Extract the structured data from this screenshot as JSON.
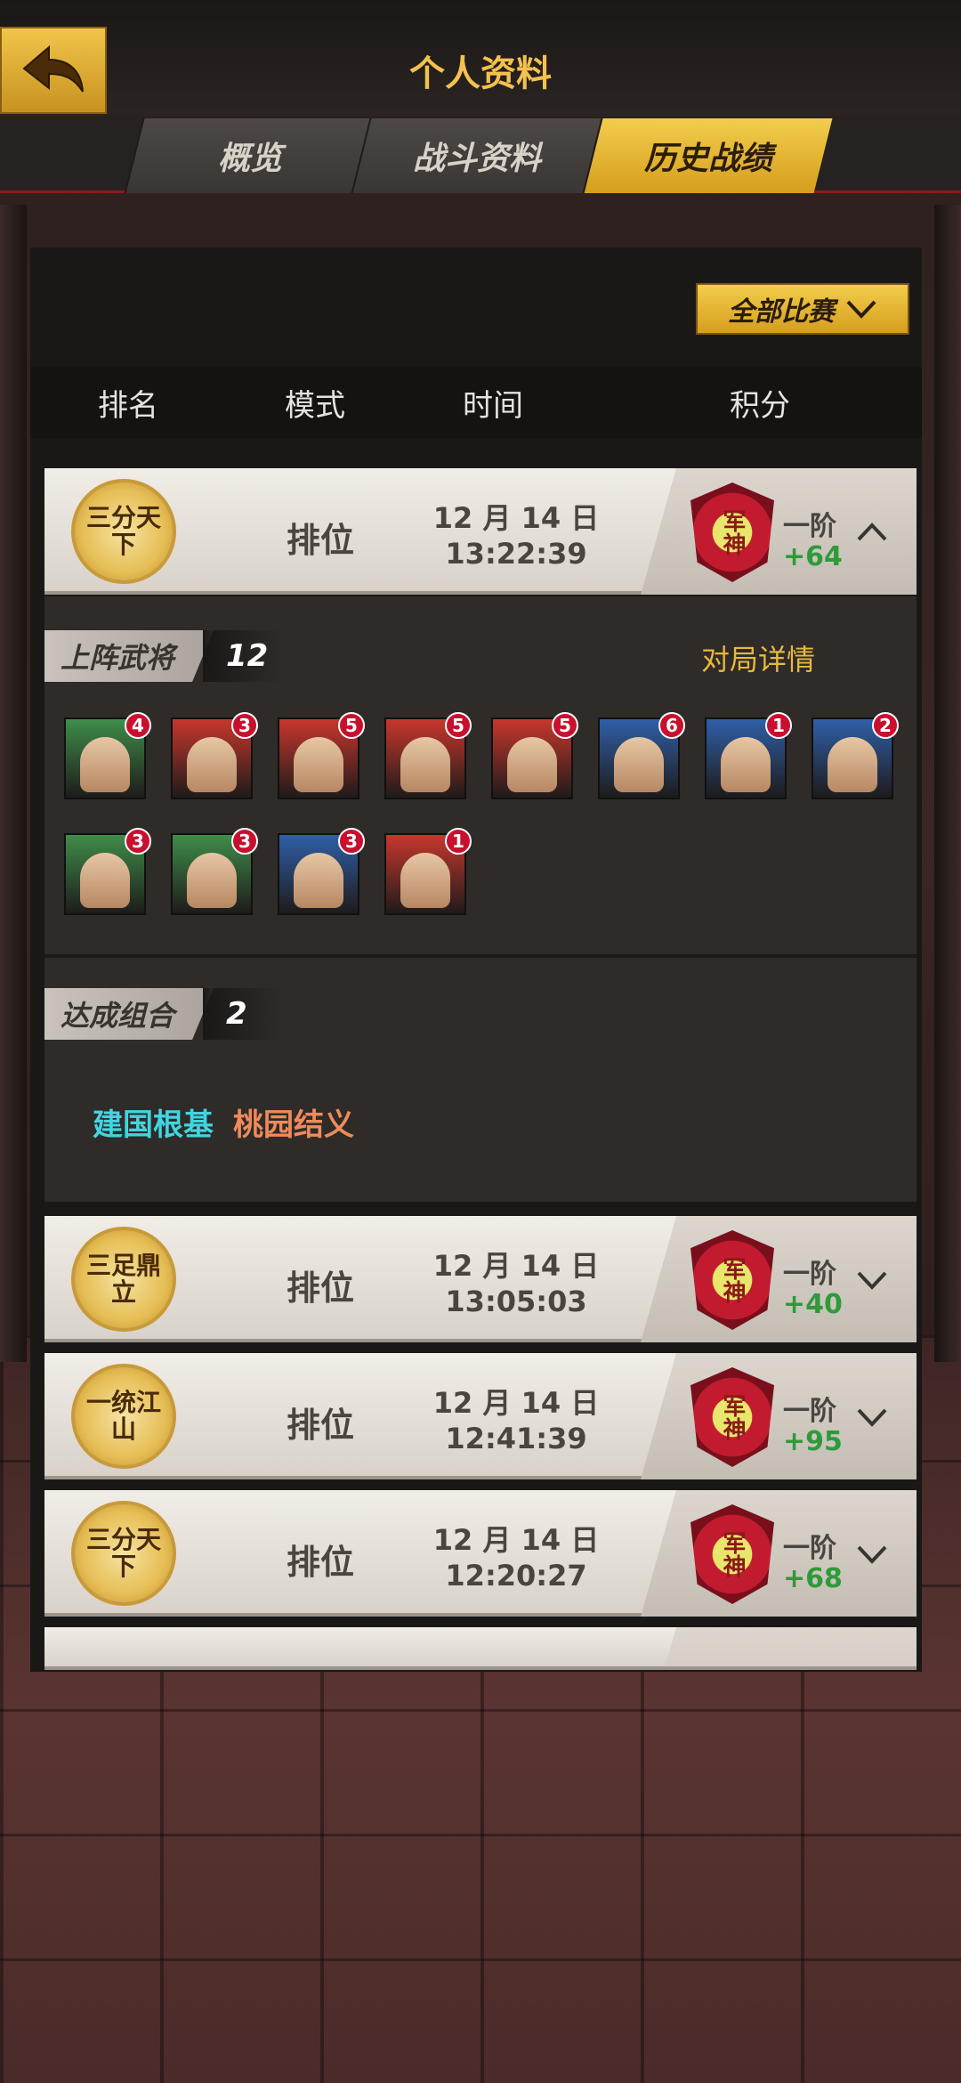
{
  "header": {
    "title": "个人资料"
  },
  "tabs": [
    {
      "label": "概览",
      "active": false
    },
    {
      "label": "战斗资料",
      "active": false
    },
    {
      "label": "历史战绩",
      "active": true
    }
  ],
  "filter": {
    "label": "全部比赛"
  },
  "columns": [
    "排名",
    "模式",
    "时间",
    "积分"
  ],
  "matches": [
    {
      "badge": "三分天下",
      "mode": "排位",
      "date": "12 月 14 日",
      "time": "13:22:39",
      "tier": "一阶",
      "score": "+64",
      "rank_name": "军神",
      "expanded": true
    },
    {
      "badge": "三足鼎立",
      "mode": "排位",
      "date": "12 月 14 日",
      "time": "13:05:03",
      "tier": "一阶",
      "score": "+40",
      "rank_name": "军神",
      "expanded": false
    },
    {
      "badge": "一统江山",
      "mode": "排位",
      "date": "12 月 14 日",
      "time": "12:41:39",
      "tier": "一阶",
      "score": "+95",
      "rank_name": "军神",
      "expanded": false
    },
    {
      "badge": "三分天下",
      "mode": "排位",
      "date": "12 月 14 日",
      "time": "12:20:27",
      "tier": "一阶",
      "score": "+68",
      "rank_name": "军神",
      "expanded": false
    }
  ],
  "detail": {
    "heroes_label": "上阵武将",
    "heroes_count": "12",
    "details_link": "对局详情",
    "heroes": [
      {
        "stars": "4",
        "color": "#3f8d4a"
      },
      {
        "stars": "3",
        "color": "#c7372d"
      },
      {
        "stars": "5",
        "color": "#c7372d"
      },
      {
        "stars": "5",
        "color": "#c7372d"
      },
      {
        "stars": "5",
        "color": "#c7372d"
      },
      {
        "stars": "6",
        "color": "#2f5fa8"
      },
      {
        "stars": "1",
        "color": "#2f5fa8"
      },
      {
        "stars": "2",
        "color": "#2f5fa8"
      },
      {
        "stars": "3",
        "color": "#3f8d4a"
      },
      {
        "stars": "3",
        "color": "#3f8d4a"
      },
      {
        "stars": "3",
        "color": "#2f5fa8"
      },
      {
        "stars": "1",
        "color": "#c7372d"
      }
    ],
    "combo_label": "达成组合",
    "combo_count": "2",
    "combos": [
      {
        "name": "建国根基",
        "color": "#3fd6e0"
      },
      {
        "name": "桃园结义",
        "color": "#f08a5a"
      }
    ]
  },
  "colors": {
    "accent": "#f2c14e",
    "score_green": "#2f9a3a",
    "link_gold": "#e8b93a"
  }
}
